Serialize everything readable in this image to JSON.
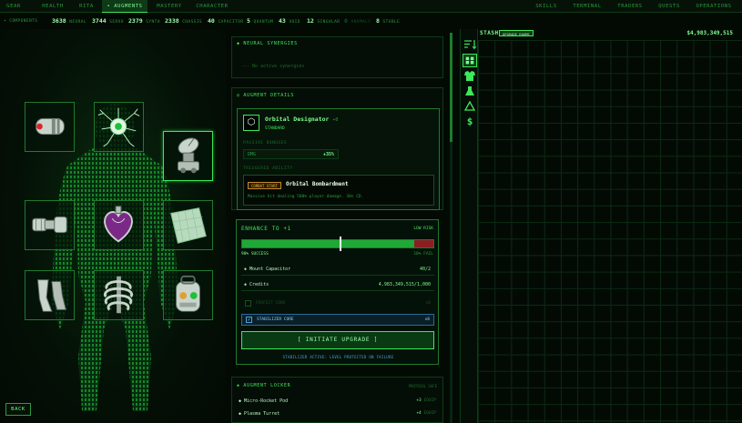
{
  "nav": {
    "tabs": [
      "GEAR",
      "HEALTH",
      "RITA",
      "• AUGMENTS",
      "MASTERY",
      "CHARACTER"
    ],
    "right_tabs": [
      "SKILLS",
      "TERMINAL",
      "TRADERS",
      "QUESTS",
      "OPERATIONS"
    ]
  },
  "components": {
    "label": "• COMPONENTS",
    "items": [
      {
        "n": "3638",
        "l": "NEURAL"
      },
      {
        "n": "3744",
        "l": "SERVO"
      },
      {
        "n": "2379",
        "l": "SYNTH"
      },
      {
        "n": "2338",
        "l": "CHASSIS"
      },
      {
        "n": "40",
        "l": "CAPACITOR"
      },
      {
        "n": "5",
        "l": "QUANTUM"
      },
      {
        "n": "43",
        "l": "VOID"
      },
      {
        "n": "12",
        "l": "SINGULAR"
      },
      {
        "n": "0",
        "l": "ANOMALY"
      },
      {
        "n": "8",
        "l": "STABLE"
      }
    ]
  },
  "synergies": {
    "title": "◆ NEURAL SYNERGIES",
    "empty": "--- No active synergies"
  },
  "details": {
    "title": "◎ AUGMENT DETAILS",
    "name": "Orbital Designator",
    "level": "+0",
    "rarity": "STANDARD",
    "passive_title": "PASSIVE BONUSES",
    "stat_name": "DMG",
    "stat_value": "+35%",
    "triggered_title": "TRIGGERED ABILITY",
    "trigger_badge": "COMBAT START",
    "ability_name": "Orbital Bombardment",
    "ability_desc": "Massive hit dealing 500% player damage. 30s CD."
  },
  "enhance": {
    "title": "ENHANCE TO +1",
    "risk": "LOW RISK",
    "success_label": "90% SUCCESS",
    "fail_label": "10% FAIL",
    "success_fraction": 0.9,
    "req1_name": "Mount Capacitor",
    "req1_value": "40/2",
    "req2_name": "Credits",
    "req2_value": "4,983,349,515/1,000",
    "perfect_core": "PERFECT CORE",
    "perfect_core_count": "x0",
    "stabilizer_core": "STABILIZER CORE",
    "stabilizer_count": "x8",
    "button": "[ INITIATE UPGRADE ]",
    "note": "STABILIZER ACTIVE: LEVEL PROTECTED ON FAILURE"
  },
  "locker": {
    "title": "◈ AUGMENT LOCKER",
    "subtitle": "PROTOCOL SAFE",
    "items": [
      {
        "name": "Micro-Rocket Pod",
        "lvl": "+3",
        "tag": "EQUIP"
      },
      {
        "name": "Plasma Turret",
        "lvl": "+4",
        "tag": "EQUIP"
      }
    ]
  },
  "stash": {
    "title": "STASH",
    "badge": "UPGRADE ROOMS",
    "credits": "$4,983,349,515"
  },
  "back": "BACK",
  "sidebar_icons": [
    "sort-icon",
    "grid-icon",
    "armor-icon",
    "flask-icon",
    "recycle-icon",
    "dollar-icon"
  ],
  "colors": {
    "accent": "#3ee85a",
    "bg": "#030a04",
    "danger": "#c0262a"
  }
}
